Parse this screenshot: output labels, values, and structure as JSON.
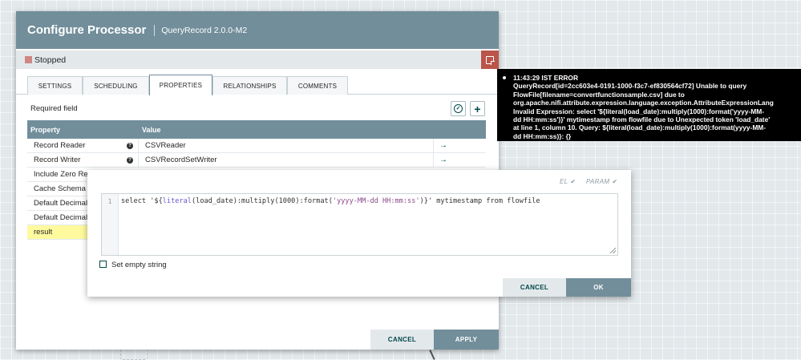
{
  "dialog": {
    "title": "Configure Processor",
    "subtitle": "QueryRecord 2.0.0-M2",
    "status": "Stopped",
    "tabs": [
      "SETTINGS",
      "SCHEDULING",
      "PROPERTIES",
      "RELATIONSHIPS",
      "COMMENTS"
    ],
    "active_tab": "PROPERTIES",
    "required_field": "Required field",
    "columns": {
      "property": "Property",
      "value": "Value"
    },
    "rows": [
      {
        "name": "Record Reader",
        "value": "CSVReader",
        "goto": "→"
      },
      {
        "name": "Record Writer",
        "value": "CSVRecordSetWriter",
        "goto": "→"
      },
      {
        "name": "Include Zero Record FlowFiles",
        "value": ""
      },
      {
        "name": "Cache Schema",
        "value": ""
      },
      {
        "name": "Default Decimal Precision",
        "value": ""
      },
      {
        "name": "Default Decimal Scale",
        "value": ""
      },
      {
        "name": "result",
        "value": ""
      }
    ],
    "cancel_label": "CANCEL",
    "apply_label": "APPLY"
  },
  "editor": {
    "el_label": "EL",
    "param_label": "PARAM",
    "check_glyph": "✔",
    "line_number": "1",
    "code_prefix": "select '${",
    "code_fn": "literal",
    "code_mid": "(load_date):multiply(1000):format(",
    "code_str": "'yyyy-MM-dd HH:mm:ss'",
    "code_suffix": ")}' mytimestamp from flowfile",
    "set_empty_label": "Set empty string",
    "cancel_label": "CANCEL",
    "ok_label": "OK"
  },
  "bulletin": {
    "time": "11:43:29 IST",
    "level": "ERROR",
    "lines": [
      "QueryRecord[id=2cc603e4-0191-1000-f3c7-ef830564cf72] Unable to query",
      "FlowFile[filename=convertfunctionsample.csv] due to",
      "org.apache.nifi.attribute.expression.language.exception.AttributeExpressionLang",
      "Invalid Expression: select '${literal(load_date):multiply(1000):format('yyyy-MM-",
      "dd HH:mm:ss')}' mytimestamp from flowfile due to Unexpected token 'load_date'",
      "at line 1, column 10. Query: ${literal(load_date):multiply(1000):format(yyyy-MM-",
      "dd HH:mm:ss)}: {}"
    ]
  },
  "colors": {
    "header": "#728e9b",
    "status_bg": "#e3e8eb",
    "stopped": "#d18686",
    "bulletin_btn": "#ba554a",
    "selected_row": "#fffa9e",
    "accent_dark": "#004849"
  },
  "icons": [
    "bulletin-note-icon",
    "verify-icon",
    "add-property-icon",
    "help-icon",
    "goto-arrow-icon",
    "check-icon",
    "resize-grip-icon"
  ]
}
